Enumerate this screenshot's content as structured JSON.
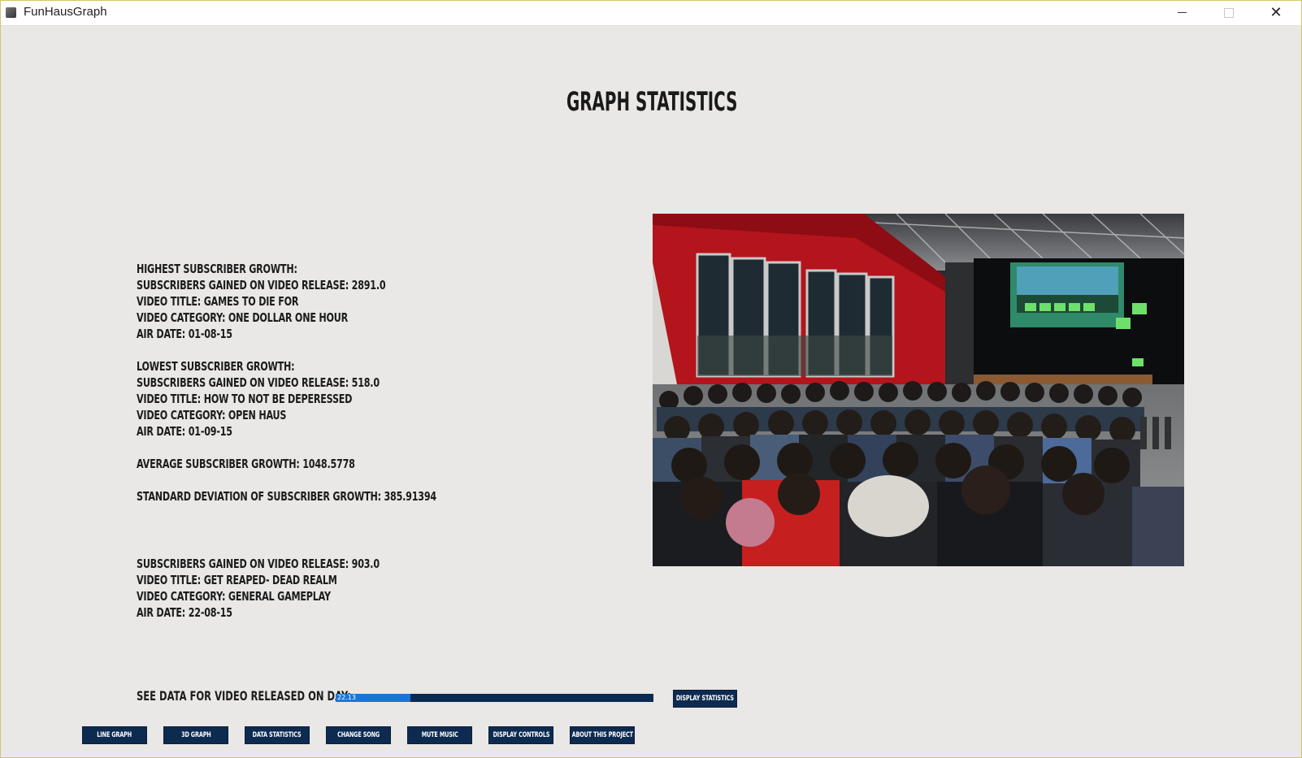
{
  "window": {
    "title": "FunHausGraph",
    "controls": [
      "minimize-icon",
      "maximize-icon",
      "close-icon"
    ]
  },
  "page": {
    "title": "GRAPH STATISTICS"
  },
  "stats": {
    "highest": {
      "heading": "HIGHEST SUBSCRIBER GROWTH:",
      "subs": "SUBSCRIBERS GAINED ON VIDEO RELEASE: 2891.0",
      "title": "VIDEO TITLE: GAMES TO DIE FOR",
      "category": "VIDEO CATEGORY: ONE DOLLAR ONE HOUR",
      "air_date": "AIR DATE: 01-08-15"
    },
    "lowest": {
      "heading": "LOWEST SUBSCRIBER GROWTH:",
      "subs": "SUBSCRIBERS GAINED ON VIDEO RELEASE: 518.0",
      "title": "VIDEO TITLE: HOW TO NOT BE DEPERESSED",
      "category": "VIDEO CATEGORY: OPEN HAUS",
      "air_date": "AIR DATE: 01-09-15"
    },
    "average": "AVERAGE SUBSCRIBER GROWTH: 1048.5778",
    "std_dev": "STANDARD DEVIATION OF SUBSCRIBER GROWTH: 385.91394",
    "selected": {
      "subs": "SUBSCRIBERS GAINED ON VIDEO RELEASE: 903.0",
      "title": "VIDEO TITLE: GET REAPED- DEAD REALM",
      "category": "VIDEO CATEGORY: GENERAL GAMEPLAY",
      "air_date": "AIR DATE: 22-08-15"
    }
  },
  "slider": {
    "label": "SEE DATA FOR VIDEO RELEASED ON DAY:",
    "value": "22.13",
    "fill_fraction": 0.235
  },
  "buttons": {
    "display_statistics": "DISPLAY STATISTICS",
    "line_graph": "LINE GRAPH",
    "graph_3d": "3D GRAPH",
    "data_statistics": "DATA STATISTICS",
    "change_song": "CHANGE SONG",
    "mute_music": "MUTE MUSIC",
    "display_controls": "DISPLAY CONTROLS",
    "about": "ABOUT THIS PROJECT"
  },
  "colors": {
    "background": "#e9e8e6",
    "button": "#0d2a50",
    "slider_fill": "#1f74d4",
    "text": "#1c1c1c"
  }
}
